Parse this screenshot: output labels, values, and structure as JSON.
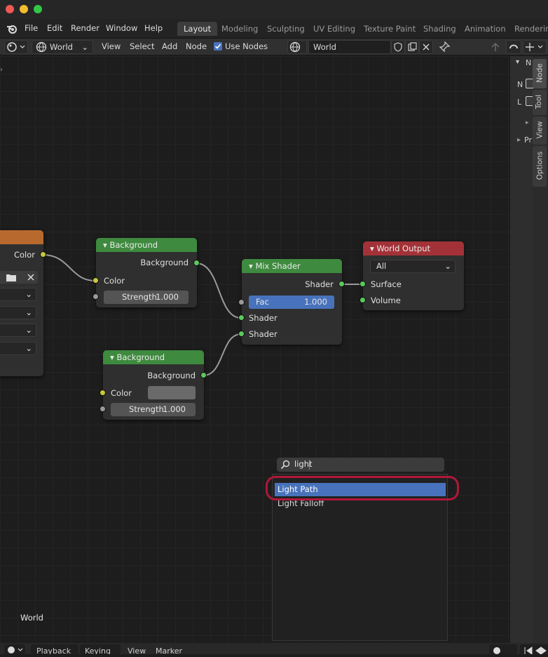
{
  "menu": [
    "File",
    "Edit",
    "Render",
    "Window",
    "Help"
  ],
  "workspace_tabs": [
    "Layout",
    "Modeling",
    "Sculpting",
    "UV Editing",
    "Texture Paint",
    "Shading",
    "Animation",
    "Rendering"
  ],
  "active_tab": "Layout",
  "header": {
    "shader_type": "World",
    "view": "View",
    "select": "Select",
    "add": "Add",
    "node": "Node",
    "use_nodes": "Use Nodes",
    "world_name": "World"
  },
  "sidebar_tabs": [
    "Node",
    "Tool",
    "View",
    "Options"
  ],
  "sidebar_labels": {
    "n": "N",
    "l": "L",
    "pr": "Pr"
  },
  "nodes": {
    "partial": {
      "output": "Color"
    },
    "background1": {
      "title": "Background",
      "output": "Background",
      "color_label": "Color",
      "strength_label": "Strength",
      "strength_value": "1.000"
    },
    "background2": {
      "title": "Background",
      "output": "Background",
      "color_label": "Color",
      "strength_label": "Strength",
      "strength_value": "1.000"
    },
    "mix_shader": {
      "title": "Mix Shader",
      "output": "Shader",
      "fac_label": "Fac",
      "fac_value": "1.000",
      "shader1": "Shader",
      "shader2": "Shader"
    },
    "world_output": {
      "title": "World Output",
      "target": "All",
      "surface": "Surface",
      "volume": "Volume"
    }
  },
  "search": {
    "query": "light",
    "results": [
      "Light Path",
      "Light Falloff"
    ],
    "selected": "Light Path"
  },
  "world_label": "World",
  "timeline": {
    "playback": "Playback",
    "keying": "Keying",
    "view": "View",
    "marker": "Marker"
  },
  "colors": {
    "node_green": "#3e8a3e",
    "node_red": "#a33238",
    "node_orange": "#b86a2e",
    "selection_blue": "#4873bc",
    "highlight_ring": "#b0173a"
  }
}
